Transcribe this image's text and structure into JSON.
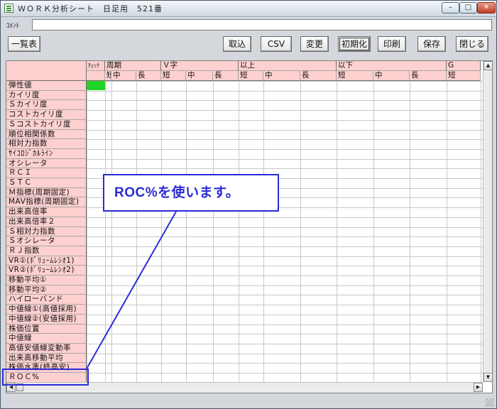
{
  "window": {
    "title": "ＷＯＲＫ分析シート　日足用　521番",
    "min_glyph": "–",
    "max_glyph": "□",
    "close_glyph": "✕"
  },
  "comment": {
    "label": "ｺﾒﾝﾄ",
    "value": ""
  },
  "toolbar": {
    "list_label": "一覧表",
    "import_label": "取込",
    "csv_label": "CSV",
    "change_label": "変更",
    "init_label": "初期化",
    "print_label": "印刷",
    "save_label": "保存",
    "close_label": "閉じる"
  },
  "grid": {
    "header_groups": [
      {
        "label": "ﾁｪｯｸ"
      },
      {
        "label": "周期"
      },
      {
        "label": "Ｖ字"
      },
      {
        "label": "以上"
      },
      {
        "label": "以下"
      },
      {
        "label": "G"
      }
    ],
    "sub_headers": [
      "短",
      "中",
      "長",
      "短",
      "中",
      "長",
      "短",
      "中",
      "長",
      "短",
      "中",
      "長",
      "短"
    ],
    "row_headers": [
      "弾性値",
      "カイリ度",
      "Ｓカイリ度",
      "コストカイリ度",
      "Ｓコストカイリ度",
      "順位相関係数",
      "相対力指数",
      "ｻｲｺﾛｼﾞｶﾙﾗｲﾝ",
      "オシレータ",
      "ＲＣＩ",
      "ＳＴＣ",
      "Ｍ指標(周期固定)",
      "MAV指標(周期固定)",
      "出来高倍率",
      "出来高倍率２",
      "Ｓ相対力指数",
      "Ｓオシレータ",
      "ＲＪ指数",
      "VR①(ﾎﾞﾘｭｰﾑﾚｼｵ1)",
      "VR②(ﾎﾞﾘｭｰﾑﾚｼｵ2)",
      "移動平均①",
      "移動平均②",
      "ハイローバンド",
      "中値線①(高値採用)",
      "中値線②(安値採用)",
      "株価位置",
      "中値線",
      "高値安値線変動率",
      "出来高移動平均",
      "株価水準(終高安)",
      "ＲＯＣ%"
    ]
  },
  "callout": {
    "text": "ROC%を使います。"
  },
  "colors": {
    "accent": "#2b2bd8",
    "header_bg": "#ffd0d0",
    "checked_cell": "#22d42a"
  }
}
